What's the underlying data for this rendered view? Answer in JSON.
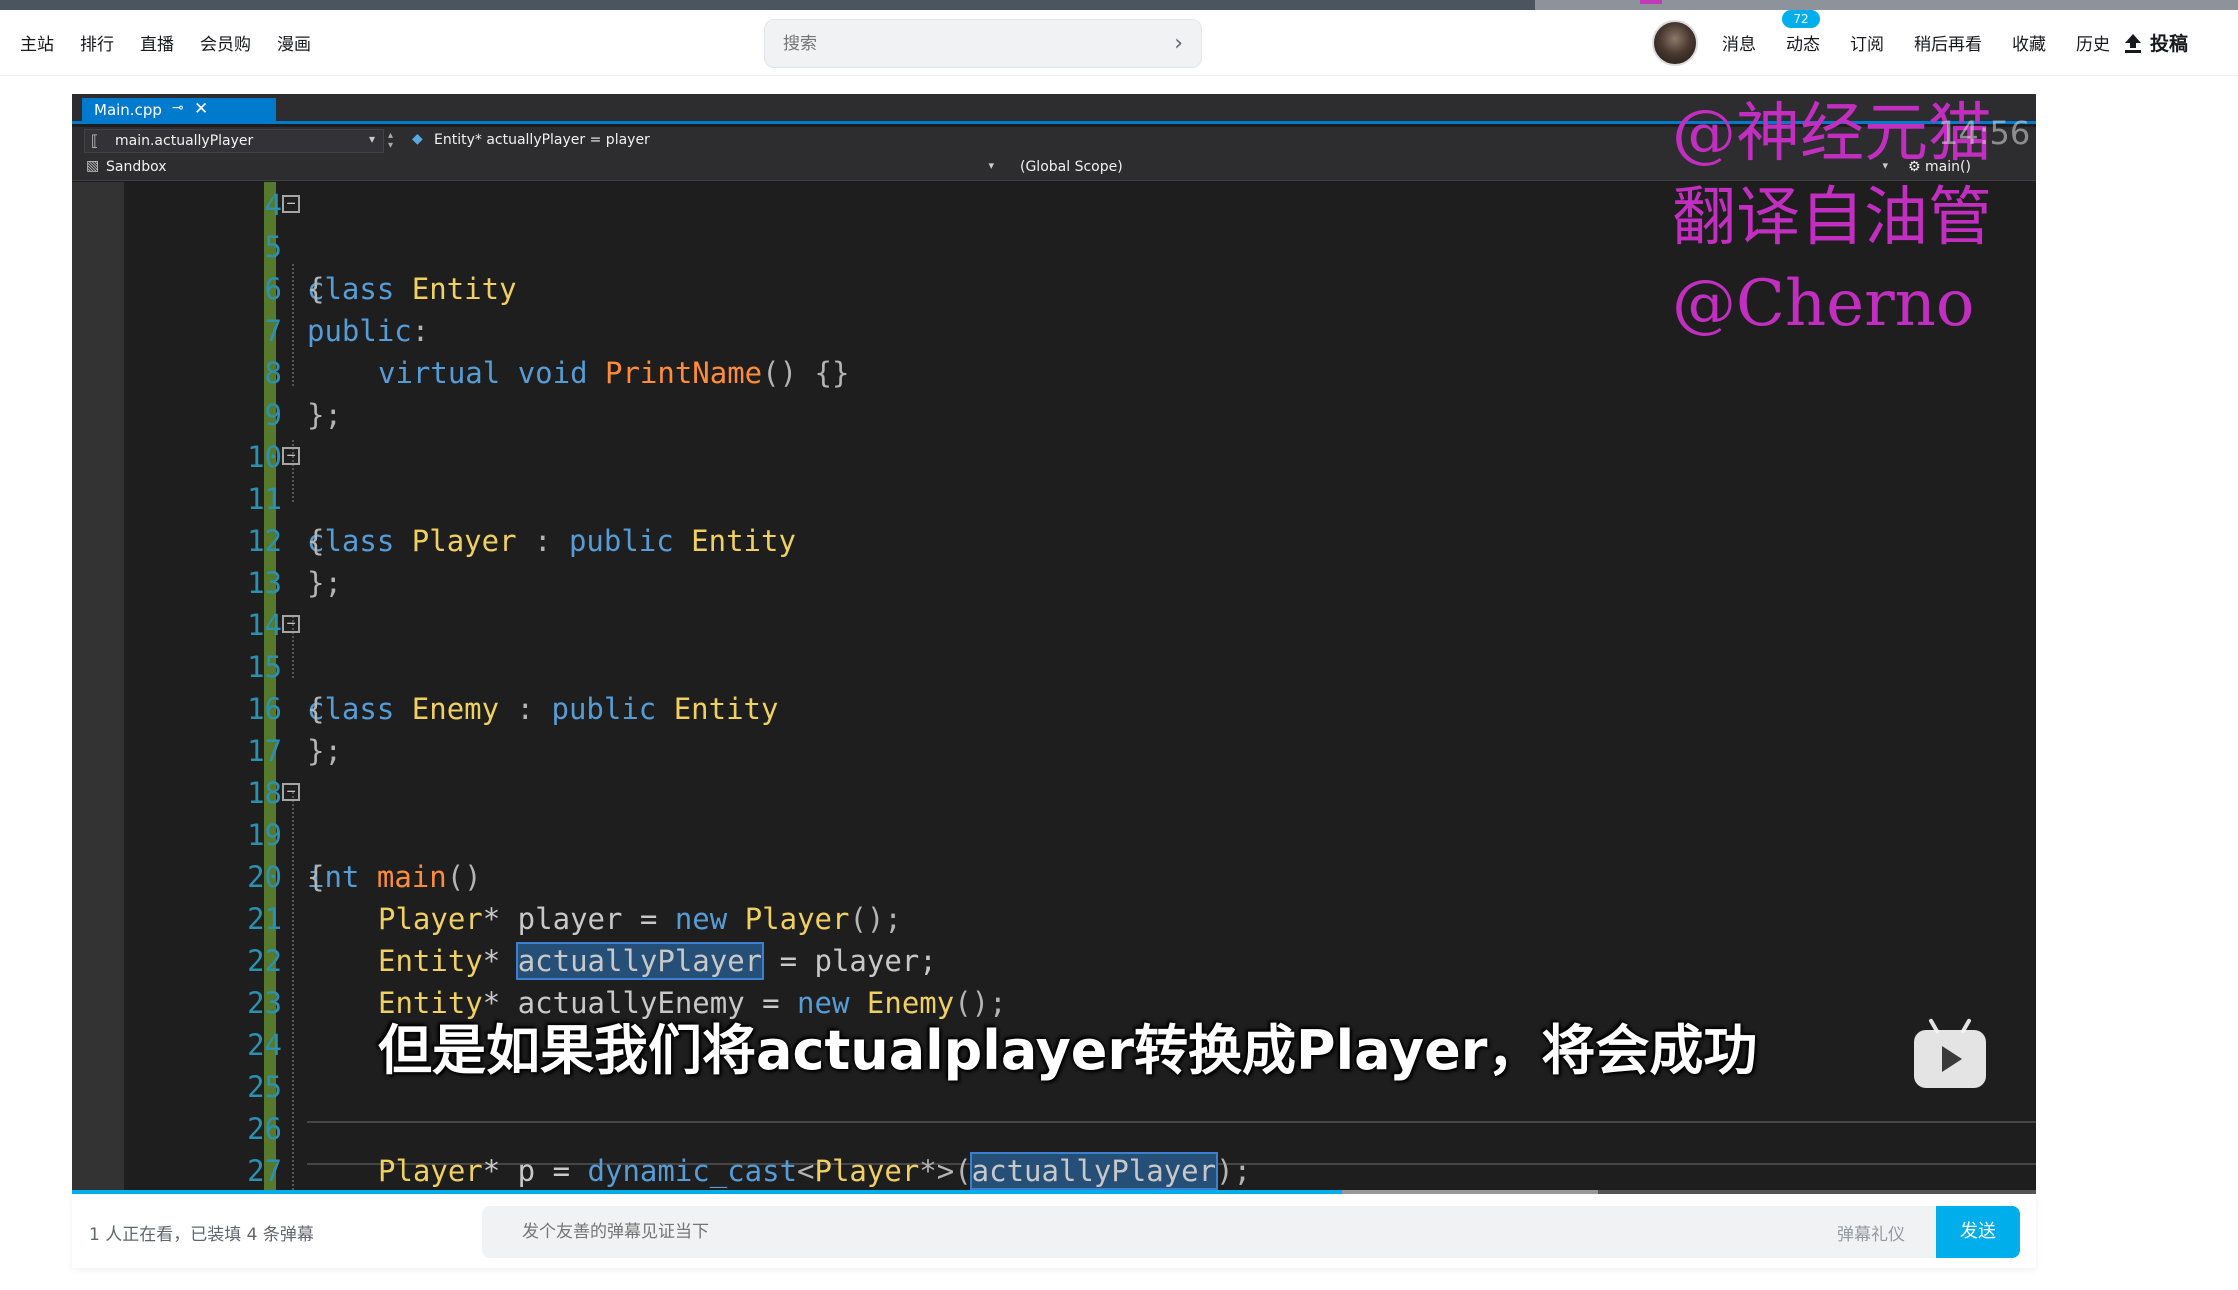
{
  "header": {
    "nav_left": [
      "主站",
      "排行",
      "直播",
      "会员购",
      "漫画"
    ],
    "search_placeholder": "搜索",
    "nav_right": [
      "消息",
      "动态",
      "订阅",
      "稍后再看",
      "收藏",
      "历史"
    ],
    "dynamic_badge": "72",
    "upload_label": "投稿"
  },
  "ide": {
    "tab_label": "Main.cpp",
    "nav_member": "main.actuallyPlayer",
    "nav_context": "Entity* actuallyPlayer = player",
    "project": "Sandbox",
    "scope": "(Global Scope)",
    "function": "main()",
    "line_numbers": [
      "4",
      "5",
      "6",
      "7",
      "8",
      "9",
      "10",
      "11",
      "12",
      "13",
      "14",
      "15",
      "16",
      "17",
      "18",
      "19",
      "20",
      "21",
      "22",
      "23",
      "24",
      "25",
      "26",
      "27"
    ],
    "code": {
      "l4_a": "class",
      "l4_b": "Entity",
      "l5": "{",
      "l6_a": "public",
      "l6_b": ":",
      "l7_a": "virtual",
      "l7_b": "void",
      "l7_c": "PrintName",
      "l7_d": "() {}",
      "l8": "};",
      "l10_a": "class",
      "l10_b": "Player",
      "l10_c": " : ",
      "l10_d": "public",
      "l10_e": "Entity",
      "l11": "{",
      "l12": "};",
      "l14_a": "class",
      "l14_b": "Enemy",
      "l14_c": " : ",
      "l14_d": "public",
      "l14_e": "Entity",
      "l15": "{",
      "l16": "};",
      "l18_a": "int",
      "l18_b": "main",
      "l18_c": "()",
      "l19": "{",
      "l20_a": "Player",
      "l20_b": "* player = ",
      "l20_c": "new",
      "l20_d": "Player",
      "l20_e": "();",
      "l21_a": "Entity",
      "l21_b": "* ",
      "l21_c": "actuallyPlayer",
      "l21_d": " = player;",
      "l22_a": "Entity",
      "l22_b": "* actuallyEnemy = ",
      "l22_c": "new",
      "l22_d": "Enemy",
      "l22_e": "();",
      "l26_a": "Player",
      "l26_b": "* p = ",
      "l26_c": "dynamic_cast",
      "l26_d": "<",
      "l26_e": "Player",
      "l26_f": "*>(",
      "l26_g": "actuallyPlayer",
      "l26_h": ");"
    }
  },
  "overlay": {
    "watermark_1": "@神经元猫",
    "watermark_2": "翻译自油管",
    "watermark_3": "@Cherno",
    "timestamp": "14:56",
    "subtitle": "但是如果我们将actualplayer转换成Player，将会成功"
  },
  "player": {
    "progress": 0.647
  },
  "danmaku": {
    "status": "1 人正在看，已装填 4 条弹幕",
    "input_placeholder": "发个友善的弹幕见证当下",
    "etiquette": "弹幕礼仪",
    "send_label": "发送"
  },
  "colors": {
    "accent": "#00aeec",
    "vs_blue": "#007acc",
    "watermark": "#c22ec0",
    "keyword": "#569cd6",
    "type": "#f0d060",
    "function": "#ff8c3a",
    "line_number": "#2b91af",
    "change_bar": "#57792b"
  }
}
